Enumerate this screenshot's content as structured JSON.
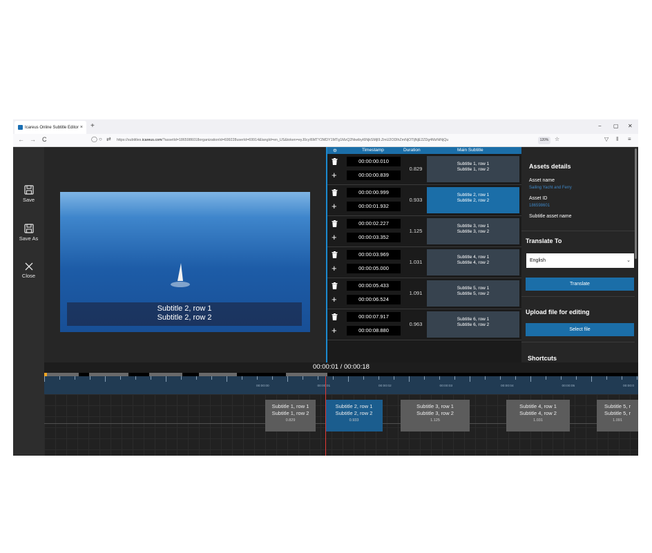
{
  "browser": {
    "tab_title": "Icareus Online Subtitle Editor",
    "tab_close": "×",
    "new_tab": "+",
    "url_prefix": "https://subtitles.",
    "url_domain": "icareus.com",
    "url_rest": "/?assetId=1865986018organizationId=699228userId=69914&langId=en_US&token=eyJ0cyI6MTY2MDY1MTg1MzQ2NiwibyI6NjkSMjI9.ZmU2ODlhZmNjOTljNjE2ZDg4MzNiNjQu",
    "zoom": "120%",
    "nav_back": "←",
    "nav_forward": "→",
    "nav_reload": "C",
    "win_min": "−",
    "win_max": "▢",
    "win_close": "✕"
  },
  "leftbar": {
    "save": "Save",
    "save_as": "Save As",
    "close": "Close"
  },
  "video": {
    "overlay_line1": "Subtitle 2, row 1",
    "overlay_line2": "Subtitle 2, row 2"
  },
  "list": {
    "headers": {
      "timestamp": "Timestamp",
      "duration": "Duration",
      "main": "Main Subtitle"
    },
    "rows": [
      {
        "start": "00:00:00.010",
        "end": "00:00:00.839",
        "duration": "0.829",
        "line1": "Subtitle 1, row 1",
        "line2": "Subtitle 1, row 2"
      },
      {
        "start": "00:00:00.999",
        "end": "00:00:01.932",
        "duration": "0.933",
        "line1": "Subtitle 2, row 1",
        "line2": "Subtitle 2, row 2"
      },
      {
        "start": "00:00:02.227",
        "end": "00:00:03.352",
        "duration": "1.125",
        "line1": "Subtitle 3, row 1",
        "line2": "Subtitle 3, row 2"
      },
      {
        "start": "00:00:03.969",
        "end": "00:00:05.000",
        "duration": "1.031",
        "line1": "Subtitle 4, row 1",
        "line2": "Subtitle 4, row 2"
      },
      {
        "start": "00:00:05.433",
        "end": "00:00:06.524",
        "duration": "1.091",
        "line1": "Subtitle 5, row 1",
        "line2": "Subtitle 5, row 2"
      },
      {
        "start": "00:00:07.917",
        "end": "00:00:08.880",
        "duration": "0.963",
        "line1": "Subtitle 6, row 1",
        "line2": "Subtitle 6, row 2"
      }
    ]
  },
  "assets": {
    "heading": "Assets details",
    "asset_name_label": "Asset name",
    "asset_name_value": "Sailing Yacht and Ferry",
    "asset_id_label": "Asset ID",
    "asset_id_value": "186598601",
    "subtitle_asset_name_label": "Subtitle asset name",
    "translate_heading": "Translate To",
    "language": "English",
    "translate_button": "Translate",
    "upload_heading": "Upload file for editing",
    "select_file_button": "Select file",
    "shortcuts_heading": "Shortcuts"
  },
  "timeline": {
    "timecode": "00:00:01 / 00:00:18",
    "ruler_labels": [
      "00:00:00",
      "00:00:01",
      "00:00:02",
      "00:00:03",
      "00:00:04",
      "00:00:05",
      "00:00:0"
    ],
    "cues": [
      {
        "line1": "Subtitle 1, row 1",
        "line2": "Subtitle 1, row 2",
        "duration": "0.829"
      },
      {
        "line1": "Subtitle 2, row 1",
        "line2": "Subtitle 2, row 2",
        "duration": "0.933"
      },
      {
        "line1": "Subtitle 3, row 1",
        "line2": "Subtitle 3, row 2",
        "duration": "1.125"
      },
      {
        "line1": "Subtitle 4, row 1",
        "line2": "Subtitle 4, row 2",
        "duration": "1.031"
      },
      {
        "line1": "Subtitle 5, r",
        "line2": "Subtitle 5, r",
        "duration": "1.091"
      }
    ]
  },
  "colors": {
    "accent": "#1b6ea8",
    "playhead": "#e53935",
    "link": "#3d86c6"
  }
}
